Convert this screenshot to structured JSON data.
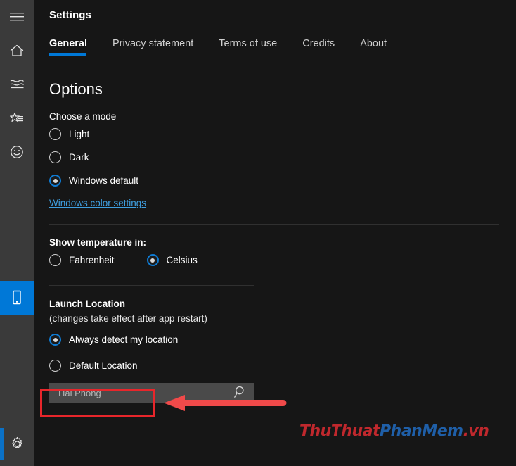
{
  "window": {
    "title": "Settings",
    "background_color": "#161616",
    "accent_color": "#0078d7"
  },
  "rail": {
    "items": [
      {
        "name": "menu",
        "icon": "hamburger-menu-icon",
        "selected": false
      },
      {
        "name": "home",
        "icon": "home-icon",
        "selected": false
      },
      {
        "name": "forecast",
        "icon": "line-chart-icon",
        "selected": false
      },
      {
        "name": "favorites",
        "icon": "star-list-icon",
        "selected": false
      },
      {
        "name": "life",
        "icon": "smiley-face-icon",
        "selected": false
      },
      {
        "name": "device",
        "icon": "phone-device-icon",
        "selected": true
      },
      {
        "name": "settings",
        "icon": "gear-icon",
        "selected": false
      }
    ]
  },
  "tabs": [
    {
      "label": "General",
      "active": true
    },
    {
      "label": "Privacy statement",
      "active": false
    },
    {
      "label": "Terms of use",
      "active": false
    },
    {
      "label": "Credits",
      "active": false
    },
    {
      "label": "About",
      "active": false
    }
  ],
  "options": {
    "heading": "Options",
    "mode": {
      "label": "Choose a mode",
      "choices": [
        {
          "label": "Light",
          "checked": false
        },
        {
          "label": "Dark",
          "checked": false
        },
        {
          "label": "Windows default",
          "checked": true
        }
      ],
      "link": "Windows color settings"
    },
    "temperature": {
      "label": "Show temperature in:",
      "choices": [
        {
          "label": "Fahrenheit",
          "checked": false
        },
        {
          "label": "Celsius",
          "checked": true
        }
      ]
    },
    "launch_location": {
      "label": "Launch Location",
      "note": "(changes take effect after app restart)",
      "choices": [
        {
          "label": "Always detect my location",
          "checked": true
        },
        {
          "label": "Default Location",
          "checked": false
        }
      ],
      "search": {
        "value": "",
        "placeholder": "Hai Phong",
        "button_icon": "search-icon"
      }
    }
  },
  "annotations": {
    "highlight_box_color": "#e8262b",
    "arrow_color": "#f04a4a",
    "arrow_direction": "left"
  },
  "watermark": {
    "part1": "ThuThuat",
    "part2": "PhanMem",
    "part3": ".vn",
    "color1": "#c0282d",
    "color2": "#1f5fa8"
  }
}
